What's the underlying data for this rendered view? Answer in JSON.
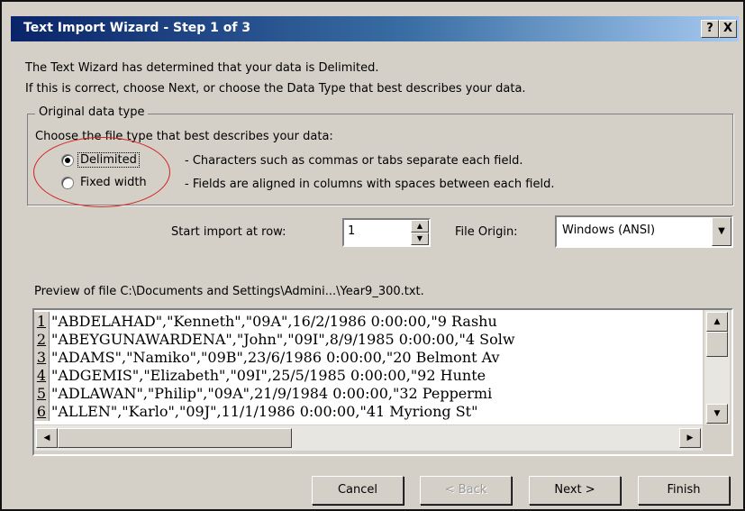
{
  "window": {
    "title": "Text Import Wizard - Step 1 of 3",
    "help_label": "?",
    "close_label": "X",
    "title_gradient": [
      "#0a246a",
      "#a6caf0"
    ]
  },
  "intro": {
    "line1": "The Text Wizard has determined that your data is Delimited.",
    "line2": "If this is correct, choose Next, or choose the Data Type that best describes your data."
  },
  "data_type": {
    "legend": "Original data type",
    "prompt": "Choose the file type that best describes your data:",
    "options": [
      {
        "label": "Delimited",
        "description": "- Characters such as commas or tabs separate each field.",
        "selected": true
      },
      {
        "label": "Fixed width",
        "description": "- Fields are aligned in columns with spaces between each field.",
        "selected": false
      }
    ],
    "highlight_color": "#d42020"
  },
  "start_row": {
    "label": "Start import at row:",
    "value": "1"
  },
  "file_origin": {
    "label": "File Origin:",
    "value": "Windows (ANSI)"
  },
  "preview": {
    "label": "Preview of file C:\\Documents and Settings\\Admini...\\Year9_300.txt.",
    "rows": [
      {
        "num": "1",
        "text": "\"ABDELAHAD\",\"Kenneth\",\"09A\",16/2/1986 0:00:00,\"9 Rashu"
      },
      {
        "num": "2",
        "text": "\"ABEYGUNAWARDENA\",\"John\",\"09I\",8/9/1985 0:00:00,\"4 Solw"
      },
      {
        "num": "3",
        "text": "\"ADAMS\",\"Namiko\",\"09B\",23/6/1986 0:00:00,\"20 Belmont Av"
      },
      {
        "num": "4",
        "text": "\"ADGEMIS\",\"Elizabeth\",\"09I\",25/5/1985 0:00:00,\"92 Hunte"
      },
      {
        "num": "5",
        "text": "\"ADLAWAN\",\"Philip\",\"09A\",21/9/1984 0:00:00,\"32 Peppermi"
      },
      {
        "num": "6",
        "text": "\"ALLEN\",\"Karlo\",\"09J\",11/1/1986 0:00:00,\"41 Myriong St\""
      }
    ]
  },
  "buttons": {
    "cancel": "Cancel",
    "back": "< Back",
    "next": "Next >",
    "finish": "Finish"
  }
}
